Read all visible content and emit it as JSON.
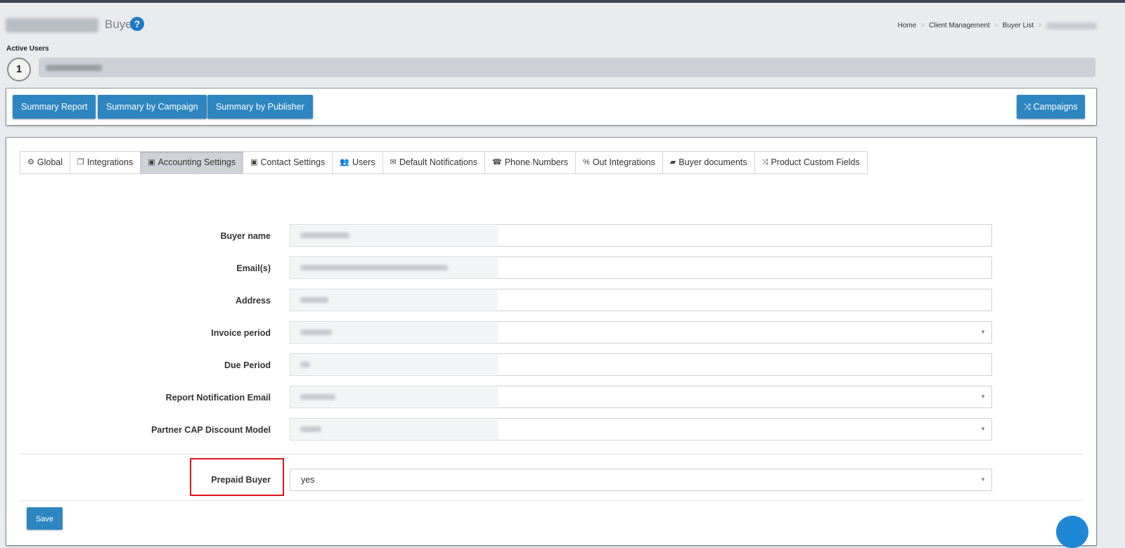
{
  "header": {
    "page_subtitle": "Buyer",
    "help_icon": "?",
    "breadcrumb": [
      "Home",
      "Client Management",
      "Buyer List"
    ]
  },
  "active_users": {
    "label": "Active Users",
    "count": "1"
  },
  "report_buttons": {
    "summary_report": "Summary Report",
    "summary_by_campaign": "Summary by Campaign",
    "summary_by_publisher": "Summary by Publisher",
    "campaigns": "Campaigns"
  },
  "tabs": [
    {
      "label": "Global",
      "icon": "cogs-icon",
      "glyph": "⚙"
    },
    {
      "label": "Integrations",
      "icon": "copy-icon",
      "glyph": "❐"
    },
    {
      "label": "Accounting Settings",
      "icon": "money-icon",
      "glyph": "▣",
      "active": true
    },
    {
      "label": "Contact Settings",
      "icon": "money-icon",
      "glyph": "▣"
    },
    {
      "label": "Users",
      "icon": "users-icon",
      "glyph": "👥"
    },
    {
      "label": "Default Notifications",
      "icon": "envelope-icon",
      "glyph": "✉"
    },
    {
      "label": "Phone Numbers",
      "icon": "phone-icon",
      "glyph": "☎"
    },
    {
      "label": "Out Integrations",
      "icon": "percent-icon",
      "glyph": "%"
    },
    {
      "label": "Buyer documents",
      "icon": "book-icon",
      "glyph": "▰"
    },
    {
      "label": "Product Custom Fields",
      "icon": "random-icon",
      "glyph": "⤨"
    }
  ],
  "form": {
    "buyer_name_label": "Buyer name",
    "emails_label": "Email(s)",
    "address_label": "Address",
    "invoice_period_label": "Invoice period",
    "due_period_label": "Due Period",
    "report_notification_email_label": "Report Notification Email",
    "partner_cap_discount_model_label": "Partner CAP Discount Model",
    "prepaid_buyer_label": "Prepaid Buyer",
    "prepaid_buyer_value": "yes"
  },
  "save_label": "Save",
  "colors": {
    "primary_button": "#2e86c1",
    "highlight_border": "#e0141e",
    "help_icon": "#1e78c8"
  }
}
